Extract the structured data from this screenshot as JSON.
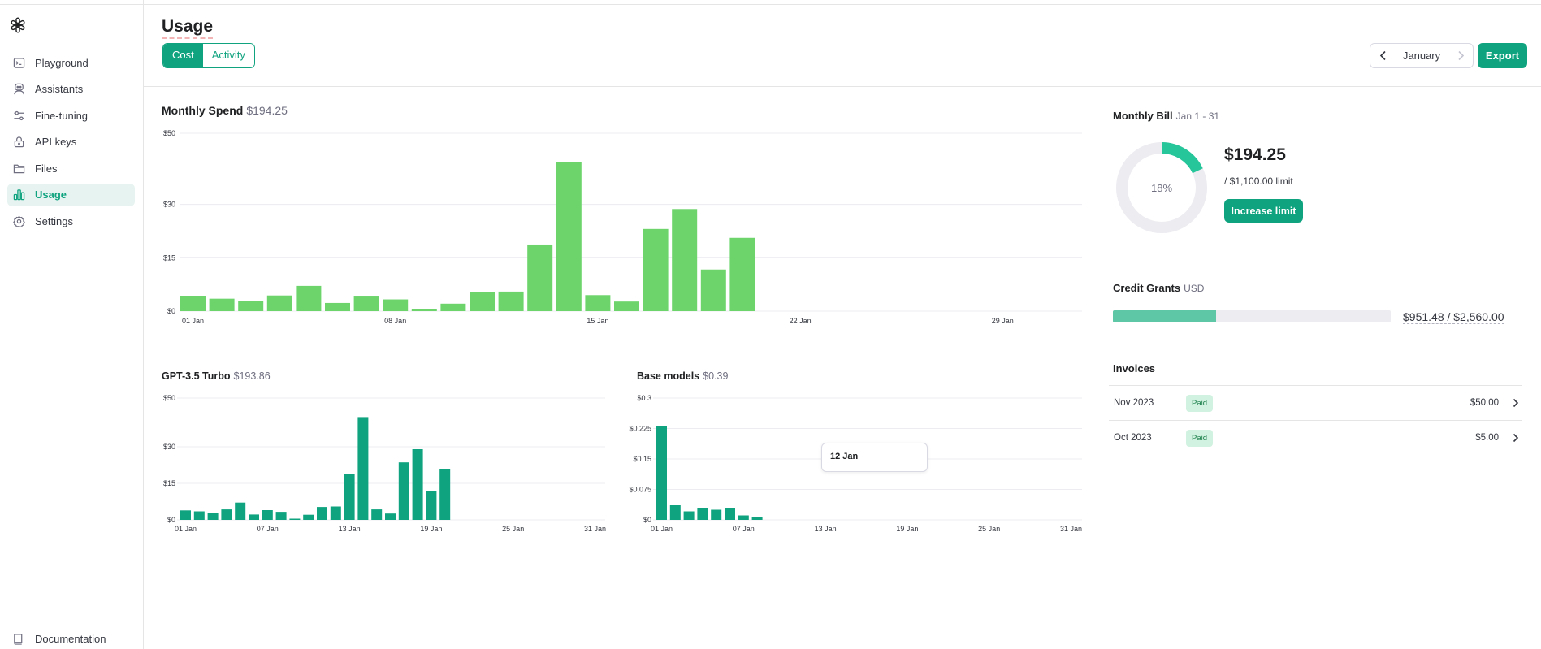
{
  "sidebar": {
    "items": [
      {
        "label": "Playground",
        "icon": "terminal-icon"
      },
      {
        "label": "Assistants",
        "icon": "assistant-icon"
      },
      {
        "label": "Fine-tuning",
        "icon": "sliders-icon"
      },
      {
        "label": "API keys",
        "icon": "lock-icon"
      },
      {
        "label": "Files",
        "icon": "folder-icon"
      },
      {
        "label": "Usage",
        "icon": "bar-chart-icon",
        "active": true
      },
      {
        "label": "Settings",
        "icon": "gear-icon"
      }
    ],
    "documentation": "Documentation"
  },
  "header": {
    "title": "Usage",
    "tabs": [
      {
        "label": "Cost",
        "active": true
      },
      {
        "label": "Activity",
        "active": false
      }
    ],
    "month": "January",
    "export_label": "Export"
  },
  "colors": {
    "accent": "#10a37f",
    "bar_main": "#6cd46a",
    "bar_model": "#10a37f"
  },
  "chart_data": [
    {
      "type": "bar",
      "title": "Monthly Spend",
      "subtitle": "$194.25",
      "y_ticks": [
        "$0",
        "$15",
        "$30",
        "$50"
      ],
      "y_tick_values": [
        0,
        15,
        30,
        50
      ],
      "ylim": [
        0,
        50
      ],
      "x_ticks": [
        "01 Jan",
        "08 Jan",
        "15 Jan",
        "22 Jan",
        "29 Jan"
      ],
      "x_tick_days": [
        1,
        8,
        15,
        22,
        29
      ],
      "days": 31,
      "values": [
        4.2,
        3.5,
        2.9,
        4.4,
        7.1,
        2.3,
        4.1,
        3.3,
        0.5,
        2.1,
        5.3,
        5.5,
        18.5,
        41.9,
        4.5,
        2.7,
        23.1,
        28.7,
        11.7,
        20.6
      ]
    },
    {
      "type": "bar",
      "title": "GPT-3.5 Turbo",
      "subtitle": "$193.86",
      "y_ticks": [
        "$0",
        "$15",
        "$30",
        "$50"
      ],
      "y_tick_values": [
        0,
        15,
        30,
        50
      ],
      "ylim": [
        0,
        50
      ],
      "x_ticks": [
        "01 Jan",
        "07 Jan",
        "13 Jan",
        "19 Jan",
        "25 Jan",
        "31 Jan"
      ],
      "x_tick_days": [
        1,
        7,
        13,
        19,
        25,
        31
      ],
      "days": 31,
      "values": [
        3.9,
        3.5,
        2.9,
        4.3,
        7.1,
        2.2,
        4.0,
        3.3,
        0.5,
        2.1,
        5.3,
        5.5,
        18.8,
        42.2,
        4.3,
        2.6,
        23.6,
        29.0,
        11.7,
        20.8
      ]
    },
    {
      "type": "bar",
      "title": "Base models",
      "subtitle": "$0.39",
      "y_ticks": [
        "$0",
        "$0.075",
        "$0.15",
        "$0.225",
        "$0.3"
      ],
      "y_tick_values": [
        0,
        0.075,
        0.15,
        0.225,
        0.3
      ],
      "ylim": [
        0,
        0.3
      ],
      "x_ticks": [
        "01 Jan",
        "07 Jan",
        "13 Jan",
        "19 Jan",
        "25 Jan",
        "31 Jan"
      ],
      "x_tick_days": [
        1,
        7,
        13,
        19,
        25,
        31
      ],
      "days": 31,
      "values": [
        0.232,
        0.036,
        0.021,
        0.028,
        0.025,
        0.029,
        0.011,
        0.008
      ]
    }
  ],
  "tooltip": {
    "label": "12 Jan"
  },
  "monthly_bill": {
    "title": "Monthly Bill",
    "range": "Jan 1 - 31",
    "percent_label": "18%",
    "percent": 0.18,
    "amount": "$194.25",
    "limit": "/ $1,100.00 limit",
    "button": "Increase limit"
  },
  "credit_grants": {
    "title": "Credit Grants",
    "currency": "USD",
    "value": "$951.48 / $2,560.00",
    "fraction": 0.372
  },
  "invoices": {
    "title": "Invoices",
    "rows": [
      {
        "date": "Nov 2023",
        "status": "Paid",
        "amount": "$50.00"
      },
      {
        "date": "Oct 2023",
        "status": "Paid",
        "amount": "$5.00"
      }
    ]
  }
}
